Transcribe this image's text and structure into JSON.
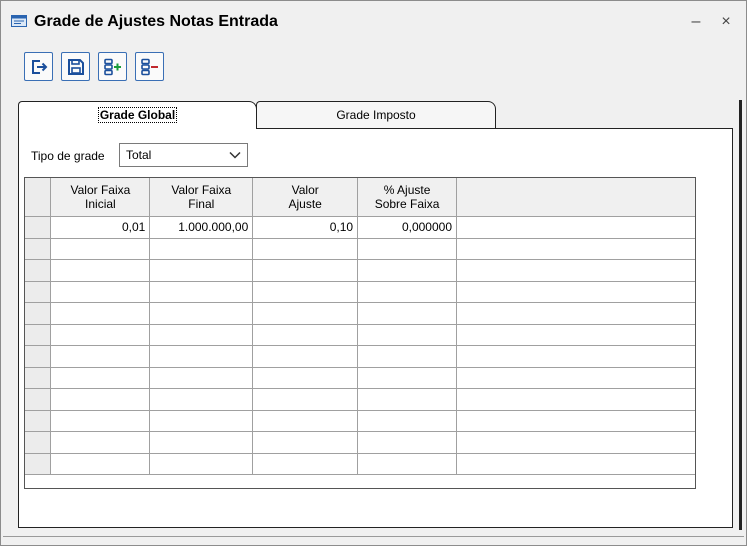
{
  "window": {
    "title": "Grade de Ajustes Notas Entrada",
    "minimize_symbol": "–",
    "close_symbol": "×"
  },
  "toolbar": {
    "buttons": [
      {
        "name": "exit-button",
        "icon": "exit-icon"
      },
      {
        "name": "save-button",
        "icon": "save-icon"
      },
      {
        "name": "add-row-button",
        "icon": "add-row-icon"
      },
      {
        "name": "remove-row-button",
        "icon": "remove-row-icon"
      }
    ]
  },
  "tabs": [
    {
      "label": "Grade Global",
      "active": true
    },
    {
      "label": "Grade Imposto",
      "active": false
    }
  ],
  "filter": {
    "label": "Tipo de grade",
    "value": "Total"
  },
  "grid": {
    "columns": [
      {
        "line1": "Valor Faixa",
        "line2": "Inicial"
      },
      {
        "line1": "Valor Faixa",
        "line2": "Final"
      },
      {
        "line1": "Valor",
        "line2": "Ajuste"
      },
      {
        "line1": "% Ajuste",
        "line2": "Sobre Faixa"
      }
    ],
    "rows": [
      [
        "0,01",
        "1.000.000,00",
        "0,10",
        "0,000000"
      ],
      [
        "",
        "",
        "",
        ""
      ],
      [
        "",
        "",
        "",
        ""
      ],
      [
        "",
        "",
        "",
        ""
      ],
      [
        "",
        "",
        "",
        ""
      ],
      [
        "",
        "",
        "",
        ""
      ],
      [
        "",
        "",
        "",
        ""
      ],
      [
        "",
        "",
        "",
        ""
      ],
      [
        "",
        "",
        "",
        ""
      ],
      [
        "",
        "",
        "",
        ""
      ],
      [
        "",
        "",
        "",
        ""
      ],
      [
        "",
        "",
        "",
        ""
      ]
    ]
  },
  "colors": {
    "accent": "#3a6fb5",
    "window_bg": "#f0f0f0"
  }
}
